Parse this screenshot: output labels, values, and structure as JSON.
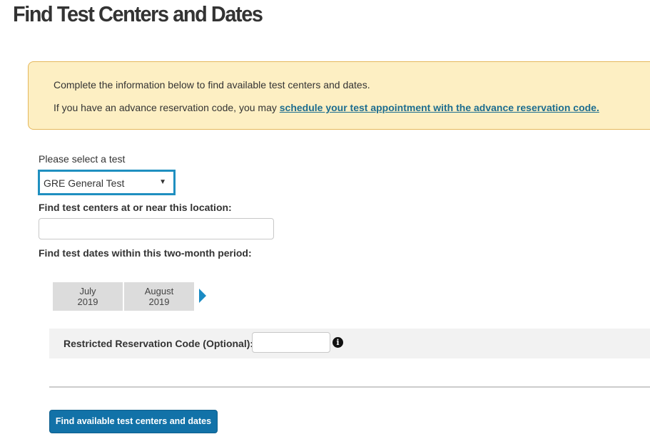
{
  "page_title": "Find Test Centers and Dates",
  "info_box": {
    "line1": "Complete the information below to find available test centers and dates.",
    "line2_prefix": "If you have an advance reservation code, you may ",
    "line2_link": "schedule your test appointment with the advance reservation code."
  },
  "test_select": {
    "label": "Please select a test",
    "selected": "GRE General Test",
    "arrow": "▼"
  },
  "location": {
    "label": "Find test centers at or near this location:",
    "value": ""
  },
  "period": {
    "label": "Find test dates within this two-month period:",
    "months": [
      {
        "month": "July",
        "year": "2019"
      },
      {
        "month": "August",
        "year": "2019"
      }
    ]
  },
  "reservation_code": {
    "label": "Restricted Reservation Code (Optional):",
    "value": "",
    "info_icon_glyph": "i"
  },
  "submit_label": "Find available test centers and dates",
  "colors": {
    "accent": "#1272a8",
    "info_bg": "#fdefc3",
    "info_border": "#e5b85c",
    "link": "#1d6d8f",
    "focus_border": "#1f8fc0"
  }
}
